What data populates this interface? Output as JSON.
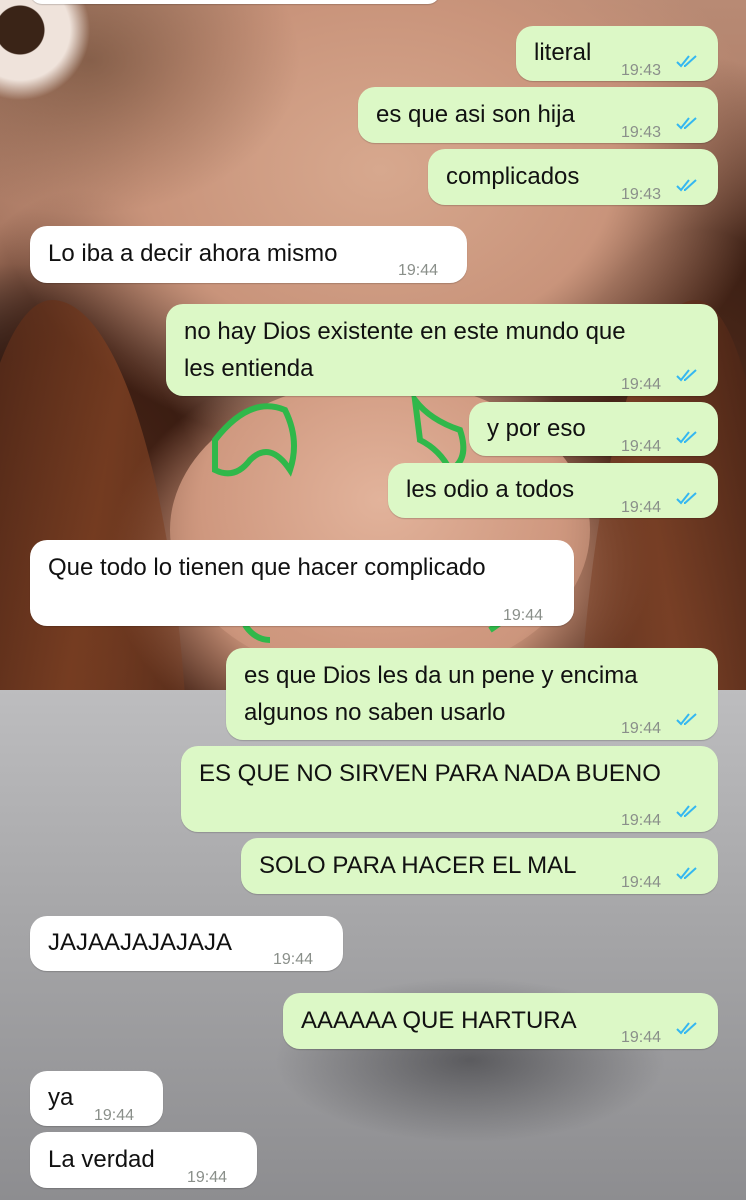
{
  "theme": {
    "outgoing_bubble": "#dcf8c6",
    "incoming_bubble": "#ffffff",
    "read_ticks": "#34b7f1"
  },
  "messages": [
    {
      "dir": "out",
      "text": "literal",
      "time": "19:43",
      "status": "read-ticks-icon"
    },
    {
      "dir": "out",
      "text": "es que asi son hija",
      "time": "19:43",
      "status": "read-ticks-icon"
    },
    {
      "dir": "out",
      "text": "complicados",
      "time": "19:43",
      "status": "read-ticks-icon"
    },
    {
      "dir": "in",
      "text": "Lo iba a decir ahora mismo",
      "time": "19:44"
    },
    {
      "dir": "out",
      "text": "no hay Dios existente en este mundo que\nles entienda",
      "time": "19:44",
      "status": "read-ticks-icon"
    },
    {
      "dir": "out",
      "text": "y por eso",
      "time": "19:44",
      "status": "read-ticks-icon"
    },
    {
      "dir": "out",
      "text": "les odio a todos",
      "time": "19:44",
      "status": "read-ticks-icon"
    },
    {
      "dir": "in",
      "text": "Que todo lo tienen que hacer complicado",
      "time": "19:44"
    },
    {
      "dir": "out",
      "text": "es que Dios les da un pene y encima\nalgunos no saben usarlo",
      "time": "19:44",
      "status": "read-ticks-icon"
    },
    {
      "dir": "out",
      "text": "ES QUE NO SIRVEN PARA NADA BUENO",
      "time": "19:44",
      "status": "read-ticks-icon"
    },
    {
      "dir": "out",
      "text": "SOLO PARA HACER EL MAL",
      "time": "19:44",
      "status": "read-ticks-icon"
    },
    {
      "dir": "in",
      "text": "JAJAAJAJAJAJA",
      "time": "19:44"
    },
    {
      "dir": "out",
      "text": "AAAAAA QUE HARTURA",
      "time": "19:44",
      "status": "read-ticks-icon"
    },
    {
      "dir": "in",
      "text": "ya",
      "time": "19:44"
    },
    {
      "dir": "in",
      "text": "La verdad",
      "time": "19:44"
    }
  ]
}
